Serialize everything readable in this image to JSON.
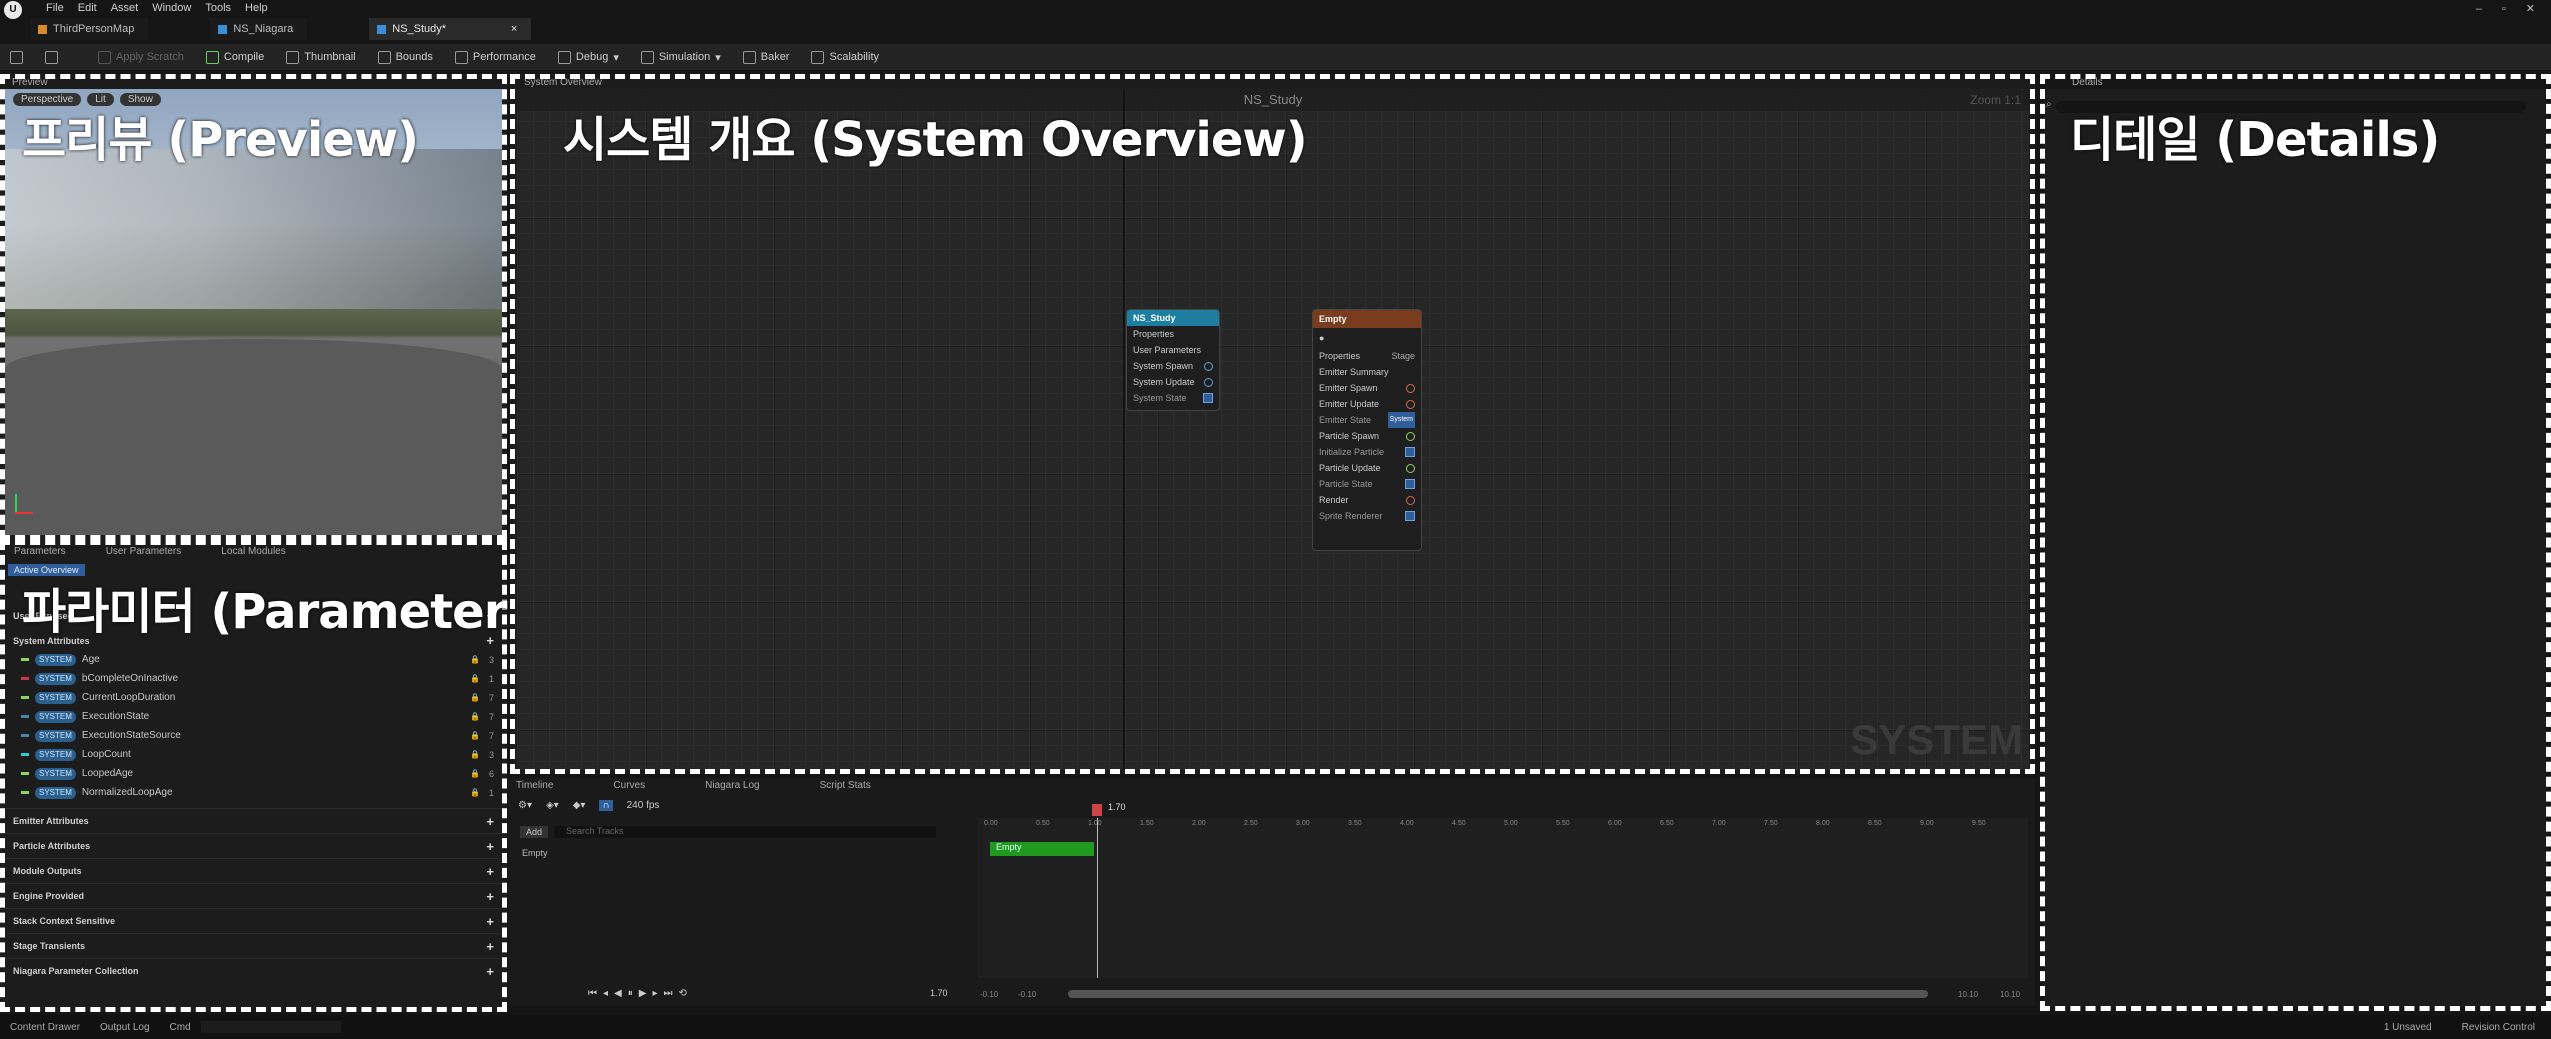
{
  "menu": {
    "logo": "U",
    "items": [
      "File",
      "Edit",
      "Asset",
      "Window",
      "Tools",
      "Help"
    ],
    "window_controls": [
      "–",
      "▫",
      "✕"
    ]
  },
  "tabs": [
    {
      "label": "ThirdPersonMap"
    },
    {
      "label": "NS_Niagara"
    },
    {
      "label": "NS_Study*"
    }
  ],
  "toolbar": {
    "apply_scratch": "Apply Scratch",
    "compile": "Compile",
    "thumbnail": "Thumbnail",
    "bounds": "Bounds",
    "performance": "Performance",
    "debug": "Debug",
    "simulation": "Simulation",
    "baker": "Baker",
    "scalability": "Scalability"
  },
  "preview": {
    "tab": "Preview",
    "perspective": "Perspective",
    "lit": "Lit",
    "show": "Show",
    "overlay_label": "프리뷰 (Preview)"
  },
  "overview": {
    "tab": "System Overview",
    "title": "NS_Study",
    "zoom": "Zoom 1:1",
    "watermark": "SYSTEM",
    "overlay_label": "시스템 개요 (System Overview)",
    "system_node": {
      "title": "NS_Study",
      "rows": [
        "Properties",
        "User Parameters",
        "System Spawn",
        "System Update",
        "System State"
      ]
    },
    "emitter_node": {
      "title": "Empty",
      "rows": [
        "Properties",
        "Emitter Summary",
        "Emitter Spawn",
        "Emitter Update",
        "Emitter State",
        "Particle Spawn",
        "Initialize Particle",
        "Particle Update",
        "Particle State",
        "Render",
        "Sprite Renderer"
      ],
      "stage": "Stage",
      "system_tag": "System"
    }
  },
  "details": {
    "tab": "Details",
    "overlay_label": "디테일 (Details)",
    "search_placeholder": ""
  },
  "parameters": {
    "tabs": [
      "Parameters",
      "User Parameters",
      "Local Modules"
    ],
    "active_overview": "Active Overview",
    "overlay_label": "파라미터 (Parameter)",
    "user_exposed": "User Exposed",
    "system_attributes": "System Attributes",
    "badge": "SYSTEM",
    "items": [
      {
        "name": "Age",
        "count": "3"
      },
      {
        "name": "bCompleteOnInactive",
        "count": "1"
      },
      {
        "name": "CurrentLoopDuration",
        "count": "7"
      },
      {
        "name": "ExecutionState",
        "count": "7"
      },
      {
        "name": "ExecutionStateSource",
        "count": "7"
      },
      {
        "name": "LoopCount",
        "count": "3"
      },
      {
        "name": "LoopedAge",
        "count": "6"
      },
      {
        "name": "NormalizedLoopAge",
        "count": "1"
      }
    ],
    "sections": [
      "Emitter Attributes",
      "Particle Attributes",
      "Module Outputs",
      "Engine Provided",
      "Stack Context Sensitive",
      "Stage Transients",
      "Niagara Parameter Collection"
    ]
  },
  "sequencer": {
    "tabs": [
      "Timeline",
      "Curves",
      "Niagara Log",
      "Script Stats"
    ],
    "fps": "240 fps",
    "add": "Add",
    "search_placeholder": "Search Tracks",
    "track": "Empty",
    "time": "1.70",
    "current_time": "1.70",
    "ticks": [
      "0.00",
      "0.50",
      "1.00",
      "1.50",
      "2.00",
      "2.50",
      "3.00",
      "3.50",
      "4.00",
      "4.50",
      "5.00",
      "5.50",
      "6.00",
      "6.50",
      "7.00",
      "7.50",
      "8.00",
      "8.50",
      "9.00",
      "9.50"
    ],
    "range_start": "-0.10",
    "range_start2": "-0.10",
    "range_end": "10.10",
    "range_end2": "10.10"
  },
  "status": {
    "content_drawer": "Content Drawer",
    "output_log": "Output Log",
    "cmd": "Cmd",
    "unsaved": "1 Unsaved",
    "revision": "Revision Control"
  }
}
